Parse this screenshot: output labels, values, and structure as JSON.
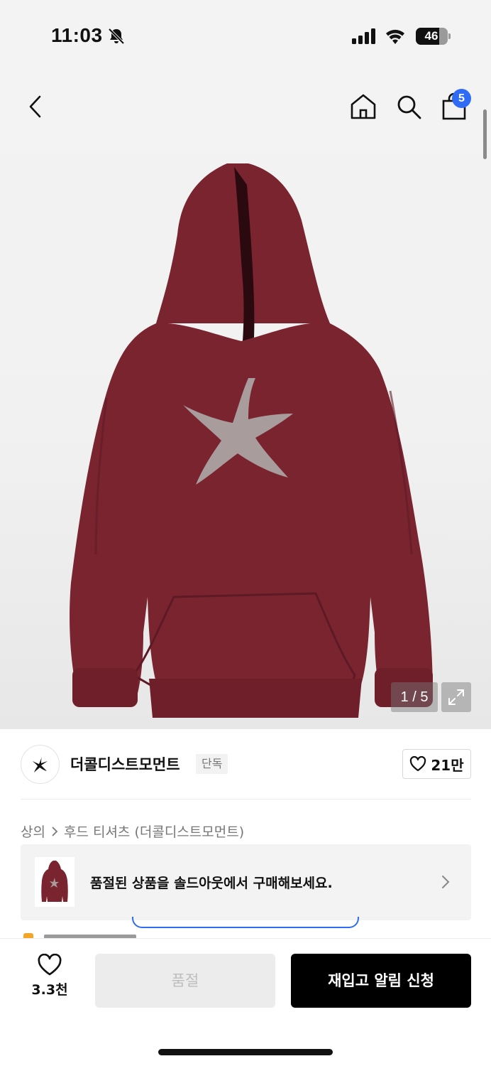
{
  "status_bar": {
    "time": "11:03",
    "battery": "46",
    "icons": [
      "bell-muted-icon",
      "signal-icon",
      "wifi-icon",
      "battery-icon"
    ]
  },
  "nav": {
    "back_icon": "chevron-left-icon",
    "home_icon": "home-icon",
    "search_icon": "search-icon",
    "cart_icon": "shopping-bag-icon",
    "cart_count": "5"
  },
  "product_image": {
    "counter": "1 / 5",
    "expand_icon": "expand-icon",
    "colors": {
      "hoodie": "#7a2430",
      "print": "#a89c9c"
    }
  },
  "brand": {
    "name": "더콜디스트모먼트",
    "tag": "단독",
    "like_count": "21만"
  },
  "breadcrumb": {
    "level1": "상의",
    "level2": "후드 티셔츠 (더콜디스트모먼트)"
  },
  "soldout_banner": {
    "text": "품절된 상품을 솔드아웃에서 구매해보세요."
  },
  "bottom_bar": {
    "wish_count": "3.3천",
    "soldout_label": "품절",
    "restock_label": "재입고 알림 신청"
  },
  "colors": {
    "accent": "#2e6cf5",
    "primary_button": "#000000",
    "disabled_button": "#ececec"
  }
}
